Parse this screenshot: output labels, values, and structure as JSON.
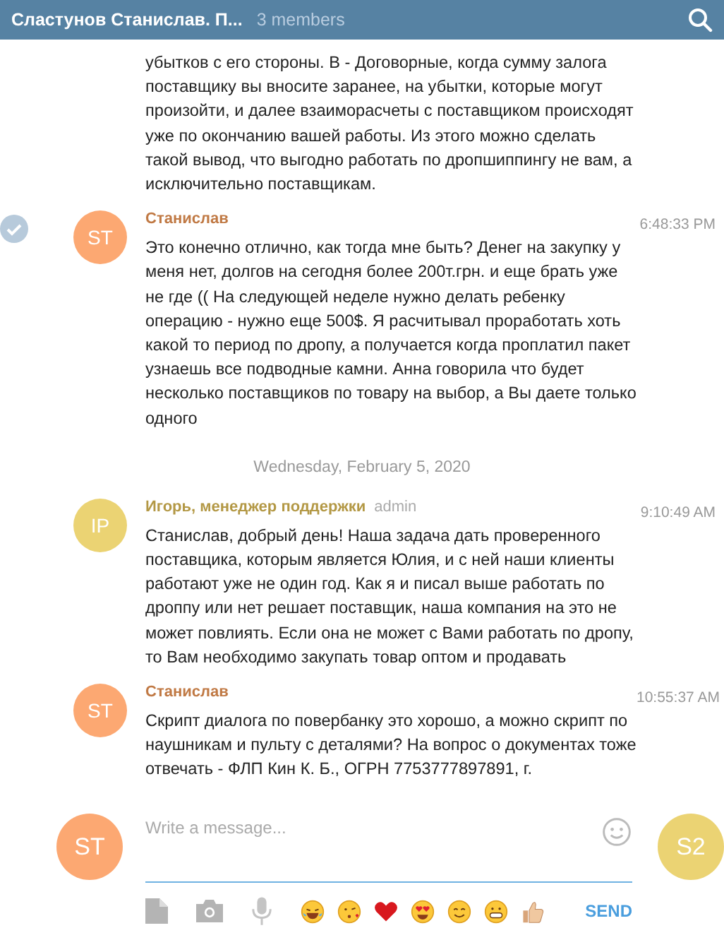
{
  "header": {
    "title": "Сластунов Станислав. П...",
    "members": "3 members"
  },
  "messages": [
    {
      "kind": "continuation",
      "selected": false,
      "text": "убытков с его стороны. В - Договорные, когда сумму залога поставщику вы вносите заранее, на убытки, которые могут произойти, и далее взаиморасчеты с поставщиком происходят уже по окончанию вашей работы. Из этого можно сделать такой вывод, что выгодно работать по дропшиппингу не вам, а исключительно поставщикам."
    },
    {
      "kind": "message",
      "selected": true,
      "avatar": "ST",
      "color": "#fca872",
      "sender": "Станислав",
      "time": "6:48:33 PM",
      "text": "Это конечно отлично, как тогда мне быть? Денег на закупку у меня нет, долгов на сегодня более 200т.грн. и еще брать уже не где (( На следующей неделе нужно делать ребенку операцию - нужно еще 500$. Я расчитывал проработать хоть какой то период по дропу, а получается когда проплатил пакет узнаешь все подводные камни. Анна говорила что будет несколько поставщиков по товару на выбор, а Вы даете только одного"
    },
    {
      "kind": "date",
      "text": "Wednesday, February 5, 2020"
    },
    {
      "kind": "message",
      "selected": false,
      "avatar": "IP",
      "color": "#ebd373",
      "sender": "Игорь, менеджер поддержки",
      "badge": "admin",
      "time": "9:10:49 AM",
      "text": "Станислав, добрый день! Наша задача дать проверенного поставщика, которым является Юлия, и с ней наши клиенты работают уже не один год. Как я и писал выше работать по дроппу или нет решает поставщик, наша компания на это не может повлиять. Если она не может с Вами работать по дропу, то Вам необходимо закупать товар оптом и продавать"
    },
    {
      "kind": "message",
      "selected": false,
      "avatar": "ST",
      "color": "#fca872",
      "sender": "Станислав",
      "time": "10:55:37 AM",
      "text": "Скрипт диалога по повербанку это хорошо, а можно скрипт по наушникам и пульту с деталями? На вопрос о документах тоже отвечать - ФЛП Кин К. Б., ОГРН 7753777897891, г."
    }
  ],
  "composer": {
    "avatars": [
      {
        "label": "ST",
        "color": "#fca872"
      },
      {
        "label": "S2",
        "color": "#ebd373"
      }
    ],
    "placeholder": "Write a message...",
    "send": "SEND"
  }
}
